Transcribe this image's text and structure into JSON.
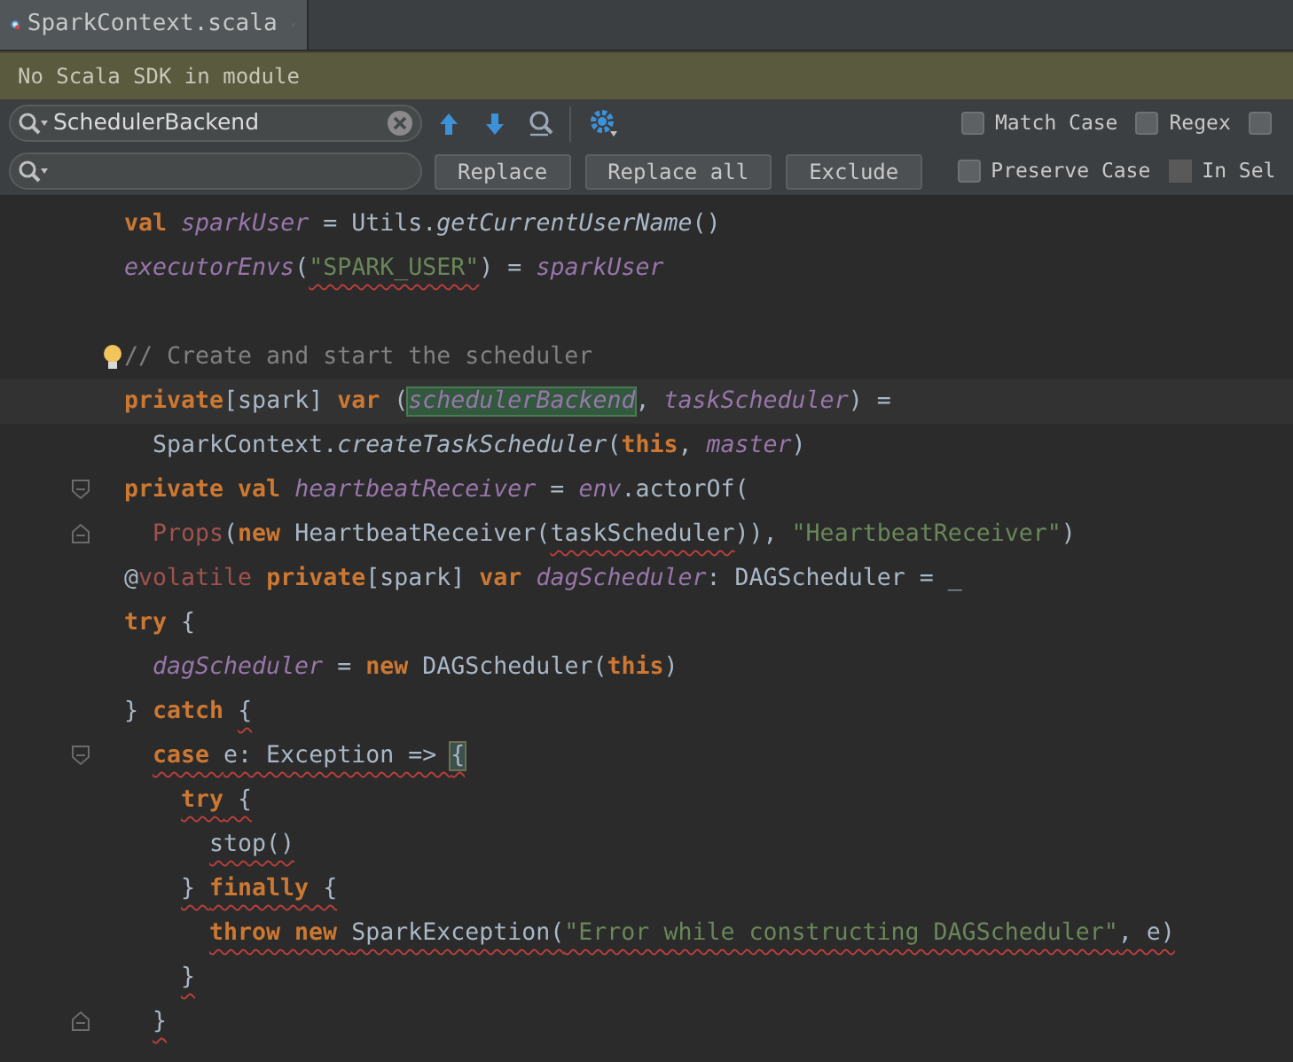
{
  "tabs": [
    {
      "label": "SparkContext.scala",
      "selected": true
    }
  ],
  "banner": "No Scala SDK in module",
  "find": {
    "search_value": "SchedulerBackend",
    "buttons": [
      "Replace",
      "Replace all",
      "Exclude"
    ],
    "options_row1": [
      {
        "label": "Match Case",
        "checked": false
      },
      {
        "label": "Regex",
        "checked": false
      },
      {
        "checked": false
      }
    ],
    "options_row2": [
      {
        "label": "Preserve Case",
        "checked": false
      },
      {
        "label": "In Sel",
        "checked": false,
        "disabled": true
      }
    ]
  },
  "code_lines": [
    {
      "tokens": [
        {
          "kind": "kw",
          "text": "    val "
        },
        {
          "kind": "field",
          "text": "sparkUser"
        },
        {
          "kind": "plain",
          "text": " = Utils."
        },
        {
          "kind": "fn",
          "text": "getCurrentUserName"
        },
        {
          "kind": "plain",
          "text": "()"
        }
      ]
    },
    {
      "tokens": [
        {
          "kind": "field",
          "text": "    executorEnvs"
        },
        {
          "kind": "plain",
          "text": "("
        },
        {
          "kind": "str",
          "text": "\"SPARK_USER\"",
          "error": true
        },
        {
          "kind": "plain",
          "text": ") = "
        },
        {
          "kind": "field",
          "text": "sparkUser"
        }
      ]
    },
    {
      "kind": "blank"
    },
    {
      "bulb": true,
      "tokens": [
        {
          "kind": "comment",
          "text": "    // Create and start the scheduler"
        }
      ]
    },
    {
      "current": true,
      "tokens": [
        {
          "kind": "kw",
          "text": "    private"
        },
        {
          "kind": "plain",
          "text": "[spark] "
        },
        {
          "kind": "kw",
          "text": "var "
        },
        {
          "kind": "plain",
          "text": "("
        },
        {
          "kind": "match",
          "text": "schedulerBackend"
        },
        {
          "kind": "plain",
          "text": ", "
        },
        {
          "kind": "field",
          "text": "taskScheduler"
        },
        {
          "kind": "plain",
          "text": ") ="
        }
      ]
    },
    {
      "tokens": [
        {
          "kind": "plain",
          "text": "      SparkContext."
        },
        {
          "kind": "fn",
          "text": "createTaskScheduler"
        },
        {
          "kind": "plain",
          "text": "("
        },
        {
          "kind": "kw",
          "text": "this"
        },
        {
          "kind": "plain",
          "text": ", "
        },
        {
          "kind": "field",
          "text": "master"
        },
        {
          "kind": "plain",
          "text": ")"
        }
      ]
    },
    {
      "fold_start": true,
      "tokens": [
        {
          "kind": "kw",
          "text": "    private val "
        },
        {
          "kind": "field",
          "text": "heartbeatReceiver"
        },
        {
          "kind": "plain",
          "text": " = "
        },
        {
          "kind": "field",
          "text": "env"
        },
        {
          "kind": "plain",
          "text": ".actorOf("
        }
      ]
    },
    {
      "fold_end": true,
      "tokens": [
        {
          "kind": "unresolved",
          "text": "      Props"
        },
        {
          "kind": "plain",
          "text": "("
        },
        {
          "kind": "kw",
          "text": "new "
        },
        {
          "kind": "plain",
          "text": "HeartbeatReceiver("
        },
        {
          "kind": "plain",
          "text": "taskScheduler",
          "error": true
        },
        {
          "kind": "plain",
          "text": ")), "
        },
        {
          "kind": "str",
          "text": "\"HeartbeatReceiver\""
        },
        {
          "kind": "plain",
          "text": ")"
        }
      ]
    },
    {
      "tokens": [
        {
          "kind": "plain",
          "text": "    @"
        },
        {
          "kind": "unresolved",
          "text": "volatile"
        },
        {
          "kind": "kw",
          "text": " private"
        },
        {
          "kind": "plain",
          "text": "[spark] "
        },
        {
          "kind": "kw",
          "text": "var "
        },
        {
          "kind": "field",
          "text": "dagScheduler"
        },
        {
          "kind": "plain",
          "text": ": DAGScheduler = _"
        }
      ]
    },
    {
      "tokens": [
        {
          "kind": "kw",
          "text": "    try"
        },
        {
          "kind": "plain",
          "text": " {"
        }
      ]
    },
    {
      "tokens": [
        {
          "kind": "field",
          "text": "      dagScheduler"
        },
        {
          "kind": "plain",
          "text": " = "
        },
        {
          "kind": "kw",
          "text": "new "
        },
        {
          "kind": "plain",
          "text": "DAGScheduler("
        },
        {
          "kind": "kw",
          "text": "this"
        },
        {
          "kind": "plain",
          "text": ")"
        }
      ]
    },
    {
      "tokens": [
        {
          "kind": "plain",
          "text": "    } "
        },
        {
          "kind": "kw",
          "text": "catch "
        },
        {
          "kind": "plain",
          "text": "{",
          "error": true
        }
      ]
    },
    {
      "error": true,
      "fold_start": true,
      "tokens": [
        {
          "kind": "kw",
          "text": "      case "
        },
        {
          "kind": "plain",
          "text": "e: Exception => "
        },
        {
          "kind": "brace",
          "text": "{"
        }
      ]
    },
    {
      "error": true,
      "tokens": [
        {
          "kind": "kw",
          "text": "        try"
        },
        {
          "kind": "plain",
          "text": " {"
        }
      ]
    },
    {
      "error": true,
      "tokens": [
        {
          "kind": "plain",
          "text": "          stop()"
        }
      ]
    },
    {
      "error": true,
      "tokens": [
        {
          "kind": "plain",
          "text": "        } "
        },
        {
          "kind": "kw",
          "text": "finally"
        },
        {
          "kind": "plain",
          "text": " {"
        }
      ]
    },
    {
      "error": true,
      "tokens": [
        {
          "kind": "kw",
          "text": "          throw new "
        },
        {
          "kind": "plain",
          "text": "SparkException("
        },
        {
          "kind": "str",
          "text": "\"Error while constructing DAGScheduler\""
        },
        {
          "kind": "plain",
          "text": ", e)"
        }
      ]
    },
    {
      "error": true,
      "tokens": [
        {
          "kind": "plain",
          "text": "        }"
        }
      ]
    },
    {
      "error": true,
      "fold_end": true,
      "tokens": [
        {
          "kind": "plain",
          "text": "      }"
        }
      ]
    }
  ]
}
